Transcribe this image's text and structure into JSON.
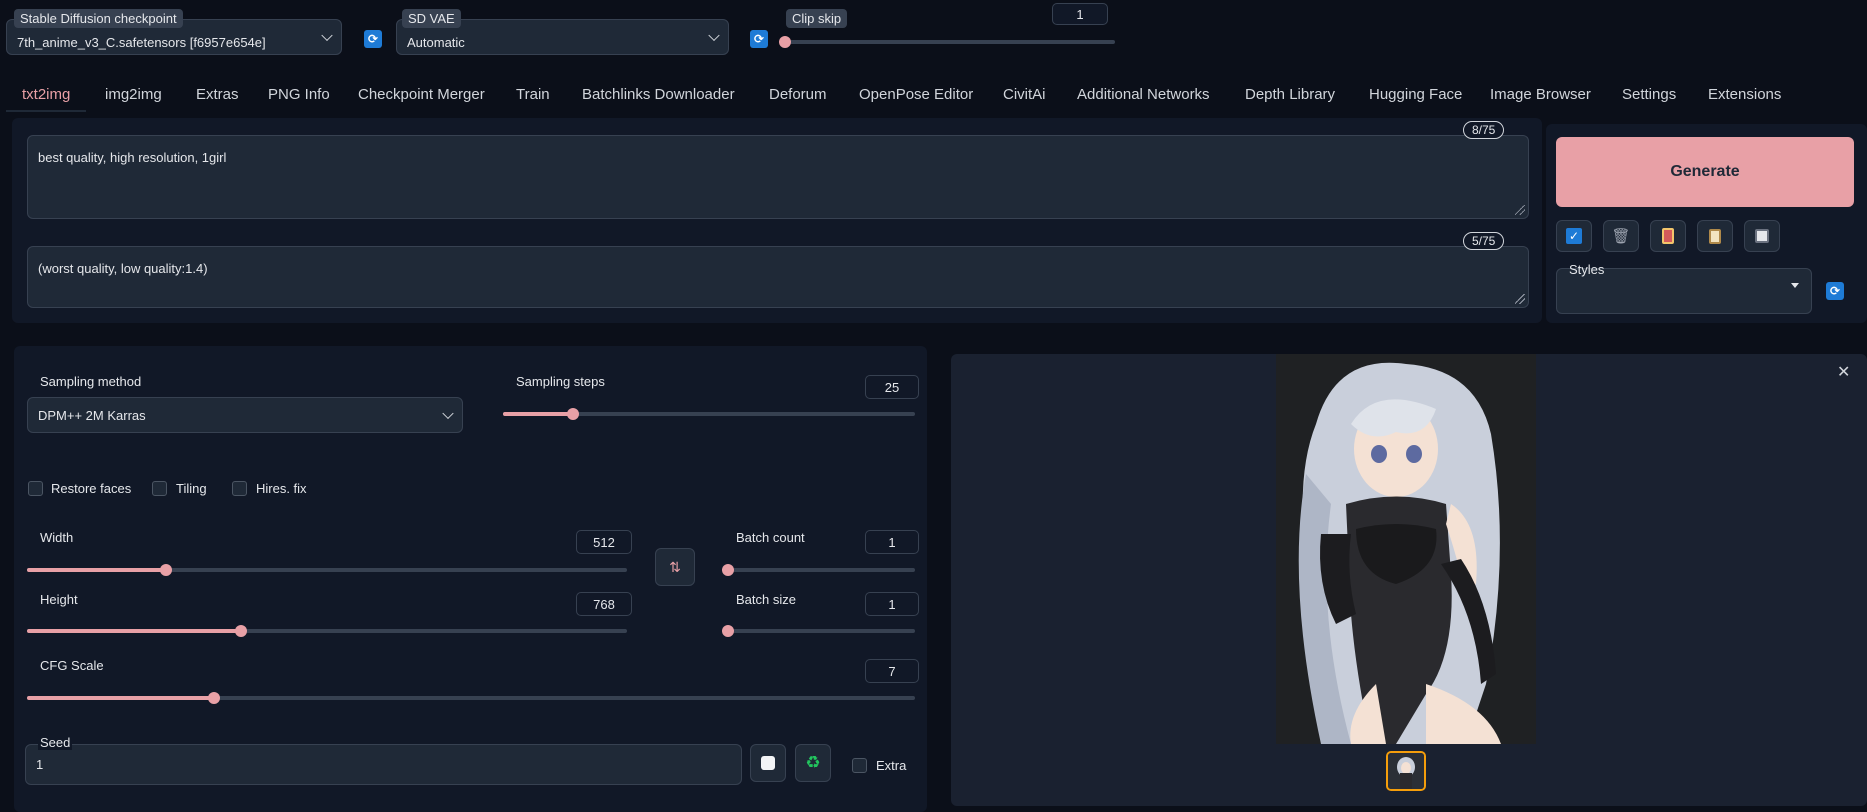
{
  "header": {
    "checkpoint": {
      "label": "Stable Diffusion checkpoint",
      "value": "7th_anime_v3_C.safetensors [f6957e654e]"
    },
    "vae": {
      "label": "SD VAE",
      "value": "Automatic"
    },
    "clip_skip": {
      "label": "Clip skip",
      "value": "1",
      "fraction": 0.0
    }
  },
  "tabs": [
    "txt2img",
    "img2img",
    "Extras",
    "PNG Info",
    "Checkpoint Merger",
    "Train",
    "Batchlinks Downloader",
    "Deforum",
    "OpenPose Editor",
    "CivitAi",
    "Additional Networks",
    "Depth Library",
    "Hugging Face",
    "Image Browser",
    "Settings",
    "Extensions"
  ],
  "active_tab": "txt2img",
  "prompt": {
    "value": "best quality, high resolution, 1girl",
    "counter": "8/75"
  },
  "negative_prompt": {
    "value": "(worst quality, low quality:1.4)",
    "counter": "5/75"
  },
  "generate_label": "Generate",
  "styles_label": "Styles",
  "sampling": {
    "method_label": "Sampling method",
    "method_value": "DPM++ 2M Karras",
    "steps_label": "Sampling steps",
    "steps_value": "25"
  },
  "checkboxes": {
    "restore_faces": "Restore faces",
    "tiling": "Tiling",
    "hires_fix": "Hires. fix",
    "extra": "Extra"
  },
  "width": {
    "label": "Width",
    "value": "512"
  },
  "height": {
    "label": "Height",
    "value": "768"
  },
  "batch_count": {
    "label": "Batch count",
    "value": "1"
  },
  "batch_size": {
    "label": "Batch size",
    "value": "1"
  },
  "cfg": {
    "label": "CFG Scale",
    "value": "7"
  },
  "seed": {
    "label": "Seed",
    "value": "1"
  },
  "colors": {
    "accent": "#e8a0a6",
    "background": "#0b0f19",
    "panel": "#1f2937"
  }
}
